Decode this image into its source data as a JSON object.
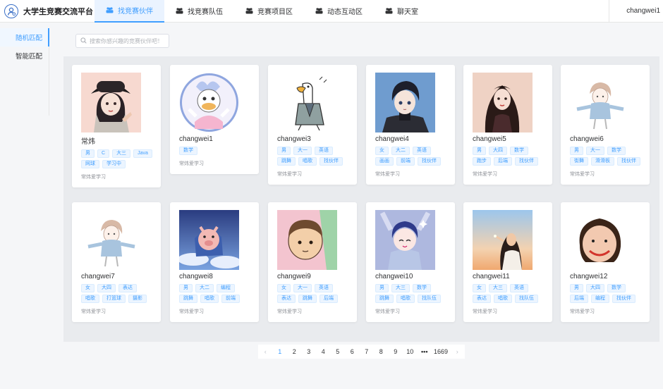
{
  "app": {
    "title": "大学生竞赛交流平台"
  },
  "nav": {
    "items": [
      {
        "label": "找竞赛伙伴",
        "icon": "group-icon",
        "active": true
      },
      {
        "label": "找竞赛队伍",
        "icon": "group-icon",
        "active": false
      },
      {
        "label": "竞赛项目区",
        "icon": "group-icon",
        "active": false
      },
      {
        "label": "动态互动区",
        "icon": "group-icon",
        "active": false
      },
      {
        "label": "聊天室",
        "icon": "group-icon",
        "active": false
      }
    ],
    "user": "changwei1"
  },
  "sidebar": {
    "items": [
      {
        "label": "随机匹配",
        "active": true
      },
      {
        "label": "智能匹配",
        "active": false
      }
    ]
  },
  "search": {
    "placeholder": "搜索你感兴趣的竞赛伙伴吧！"
  },
  "cards": [
    {
      "name": "常炜",
      "tags": [
        "男",
        "C",
        "大三",
        "Java",
        "网球",
        "学习中"
      ],
      "motto": "常炜爱学习",
      "avatar": "avatar-girl-hat"
    },
    {
      "name": "changwei1",
      "tags": [
        "数学"
      ],
      "motto": "常炜爱学习",
      "avatar": "avatar-duck-pink"
    },
    {
      "name": "changwei3",
      "tags": [
        "男",
        "大一",
        "英语",
        "跳舞",
        "唱歌",
        "找伙伴"
      ],
      "motto": "常炜爱学习",
      "avatar": "avatar-goose-sketch"
    },
    {
      "name": "changwei4",
      "tags": [
        "女",
        "大二",
        "英语",
        "画画",
        "前端",
        "找伙伴"
      ],
      "motto": "常炜爱学习",
      "avatar": "avatar-boy-anime"
    },
    {
      "name": "changwei5",
      "tags": [
        "男",
        "大四",
        "数学",
        "跑步",
        "后端",
        "找伙伴"
      ],
      "motto": "常炜爱学习",
      "avatar": "avatar-girl-longhair"
    },
    {
      "name": "changwei6",
      "tags": [
        "男",
        "大一",
        "数学",
        "街舞",
        "滑滑板",
        "找伙伴"
      ],
      "motto": "常炜爱学习",
      "avatar": "avatar-girl-sketch"
    },
    {
      "name": "changwei7",
      "tags": [
        "女",
        "大四",
        "表达",
        "唱歌",
        "打篮球",
        "摄影"
      ],
      "motto": "常炜爱学习",
      "avatar": "avatar-girl-sketch"
    },
    {
      "name": "changwei8",
      "tags": [
        "男",
        "大二",
        "编程",
        "跳舞",
        "唱歌",
        "前端"
      ],
      "motto": "常炜爱学习",
      "avatar": "avatar-pig-sky"
    },
    {
      "name": "changwei9",
      "tags": [
        "女",
        "大一",
        "英语",
        "表达",
        "跳舞",
        "后端"
      ],
      "motto": "常炜爱学习",
      "avatar": "avatar-boy-cartoon"
    },
    {
      "name": "changwei10",
      "tags": [
        "男",
        "大三",
        "数学",
        "跳舞",
        "唱歌",
        "找队伍"
      ],
      "motto": "常炜爱学习",
      "avatar": "avatar-boy-blue"
    },
    {
      "name": "changwei11",
      "tags": [
        "女",
        "大三",
        "英语",
        "表达",
        "唱歌",
        "找队伍"
      ],
      "motto": "常炜爱学习",
      "avatar": "avatar-girl-sunset"
    },
    {
      "name": "changwei12",
      "tags": [
        "男",
        "大四",
        "数学",
        "后端",
        "编程",
        "找伙伴"
      ],
      "motto": "常炜爱学习",
      "avatar": "avatar-smile-face"
    }
  ],
  "pagination": {
    "pages": [
      "1",
      "2",
      "3",
      "4",
      "5",
      "6",
      "7",
      "8",
      "9",
      "10"
    ],
    "ellipsis": "•••",
    "last": "1669",
    "current": 1,
    "prev_icon": "‹",
    "next_icon": "›"
  },
  "colors": {
    "accent": "#409eff",
    "panel": "#e9ebee"
  }
}
